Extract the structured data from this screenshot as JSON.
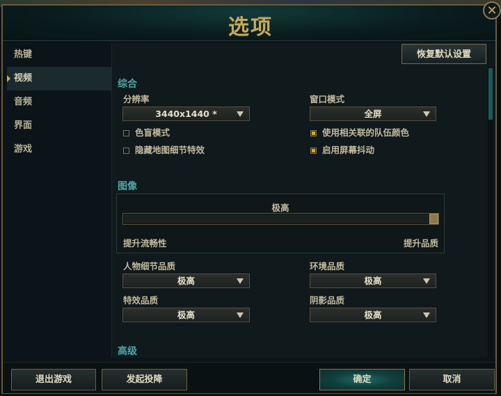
{
  "window": {
    "title": "选项",
    "close_glyph": "✕"
  },
  "sidebar": {
    "items": [
      {
        "label": "热键",
        "active": false
      },
      {
        "label": "视频",
        "active": true
      },
      {
        "label": "音频",
        "active": false
      },
      {
        "label": "界面",
        "active": false
      },
      {
        "label": "游戏",
        "active": false
      }
    ]
  },
  "toolbar": {
    "reset_label": "恢复默认设置"
  },
  "general": {
    "section_title": "综合",
    "resolution": {
      "label": "分辨率",
      "value": "3440x1440 *"
    },
    "window_mode": {
      "label": "窗口模式",
      "value": "全屏"
    },
    "checkboxes": [
      {
        "label": "色盲模式",
        "checked": false
      },
      {
        "label": "隐藏地图细节特效",
        "checked": false
      },
      {
        "label": "使用相关联的队伍颜色",
        "checked": true
      },
      {
        "label": "启用屏幕抖动",
        "checked": true
      }
    ]
  },
  "graphics": {
    "section_title": "图像",
    "level_label": "极高",
    "slider_value": 1.0,
    "left_label": "提升流畅性",
    "right_label": "提升品质",
    "character_quality": {
      "label": "人物细节品质",
      "value": "极高"
    },
    "environment_quality": {
      "label": "环境品质",
      "value": "极高"
    },
    "effects_quality": {
      "label": "特效品质",
      "value": "极高"
    },
    "shadow_quality": {
      "label": "阴影品质",
      "value": "极高"
    }
  },
  "advanced": {
    "section_title": "高级"
  },
  "footer": {
    "exit_label": "退出游戏",
    "surrender_label": "发起投降",
    "ok_label": "确定",
    "cancel_label": "取消"
  },
  "colors": {
    "accent_gold": "#c9a85a",
    "section_teal": "#4fa6a6",
    "checkbox_gold": "#d6a93c"
  }
}
